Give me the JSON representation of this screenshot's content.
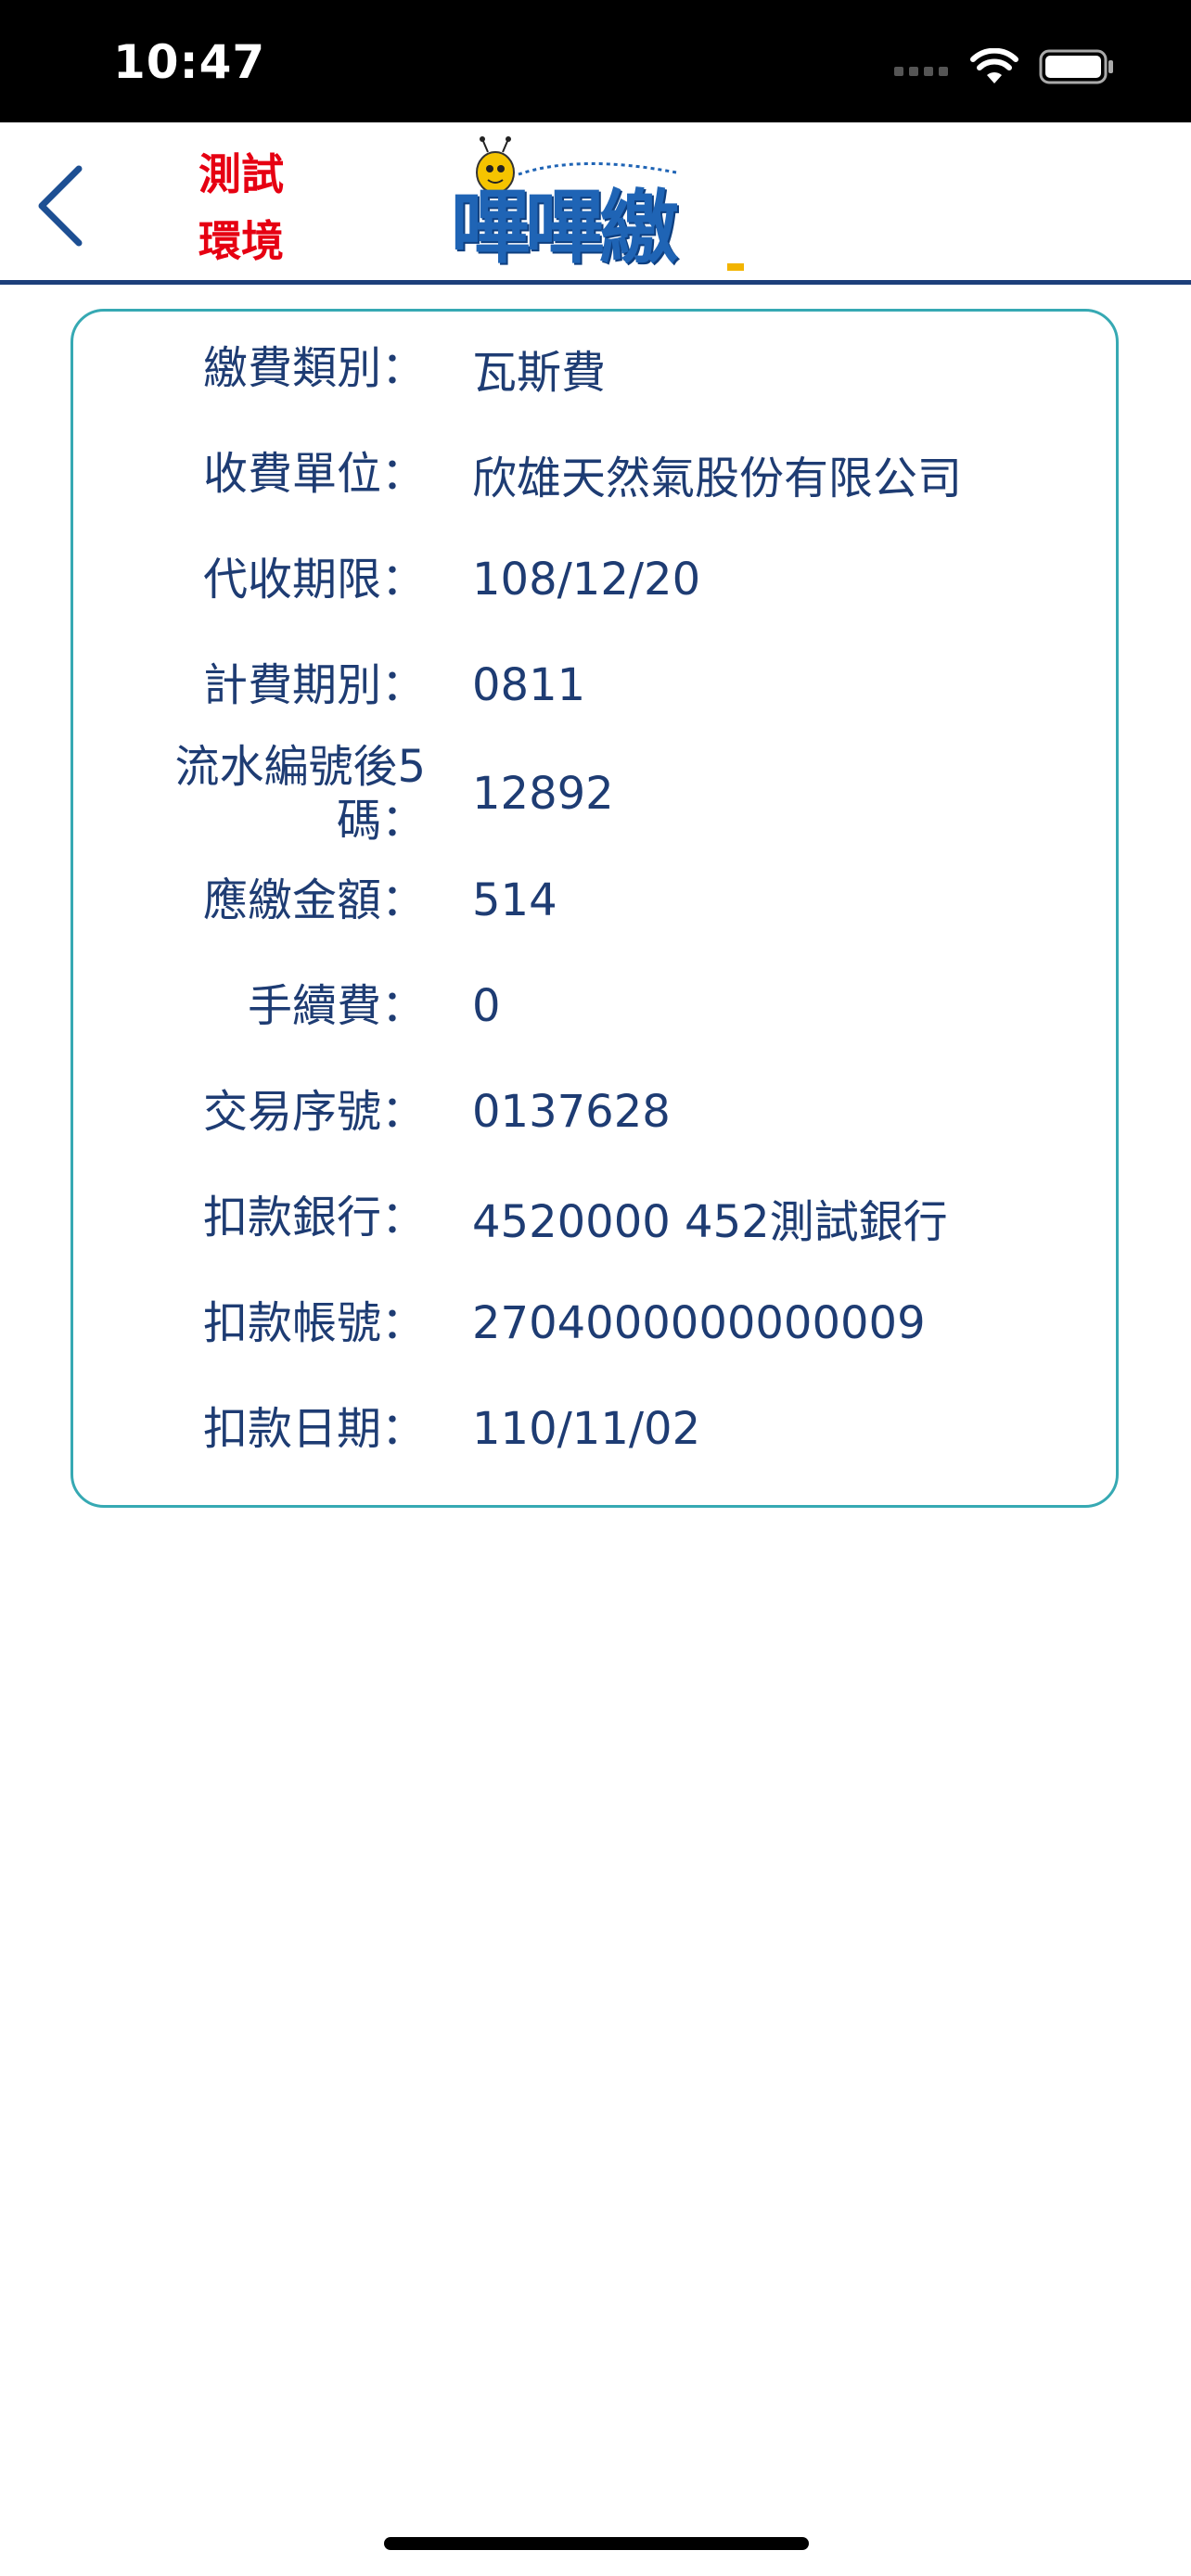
{
  "status_bar": {
    "time": "10:47"
  },
  "nav": {
    "env_label_line1": "測試",
    "env_label_line2": "環境",
    "logo_text": "嗶嗶繳"
  },
  "details": [
    {
      "label": "繳費類別：",
      "value": "瓦斯費"
    },
    {
      "label": "收費單位：",
      "value": "欣雄天然氣股份有限公司"
    },
    {
      "label": "代收期限：",
      "value": "108/12/20"
    },
    {
      "label": "計費期別：",
      "value": "0811"
    },
    {
      "label": "流水編號後5碼：",
      "value": "12892"
    },
    {
      "label": "應繳金額：",
      "value": "514"
    },
    {
      "label": "手續費：",
      "value": "0"
    },
    {
      "label": "交易序號：",
      "value": "0137628"
    },
    {
      "label": "扣款銀行：",
      "value": "4520000 452測試銀行"
    },
    {
      "label": "扣款帳號：",
      "value": "2704000000000009"
    },
    {
      "label": "扣款日期：",
      "value": "110/11/02"
    }
  ],
  "colors": {
    "accent": "#1e3c73",
    "card_border": "#36a9b3",
    "env_label": "#e60012",
    "logo_blue": "#1f64b5"
  },
  "icons": {
    "back": "chevron-left-icon",
    "signal": "signal-icon",
    "wifi": "wifi-icon",
    "battery": "battery-icon",
    "mascot": "bee-mascot-icon"
  }
}
